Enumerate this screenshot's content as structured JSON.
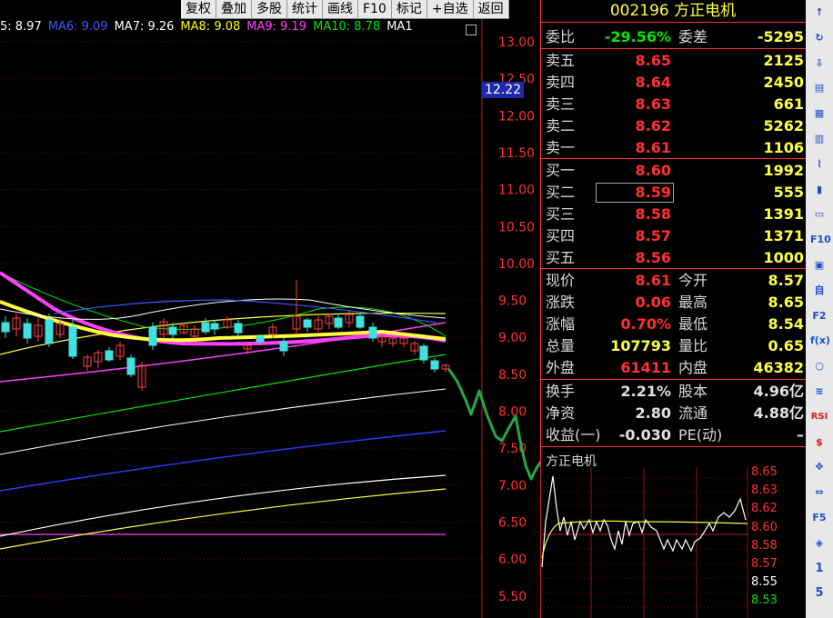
{
  "toolbar": [
    "复权",
    "叠加",
    "多股",
    "统计",
    "画线",
    "F10",
    "标记",
    "+自选",
    "返回"
  ],
  "ma_row": [
    {
      "text": "5: 8.97",
      "color": "#ffffff"
    },
    {
      "text": "MA6: 9.09",
      "color": "#3a5bff"
    },
    {
      "text": "MA7: 9.26",
      "color": "#ffffff"
    },
    {
      "text": "MA8: 9.08",
      "color": "#ffff00"
    },
    {
      "text": "MA9: 9.19",
      "color": "#ff40ff"
    },
    {
      "text": "MA10: 8.78",
      "color": "#00e600"
    },
    {
      "text": "MA1",
      "color": "#ffffff"
    }
  ],
  "axis_labels": [
    "13.00",
    "12.50",
    "12.00",
    "11.50",
    "11.00",
    "10.50",
    "10.00",
    "9.50",
    "9.00",
    "8.50",
    "8.00",
    "7.50",
    "7.00",
    "6.50",
    "6.00",
    "5.50"
  ],
  "price_tag": "12.22",
  "stock": {
    "code": "002196",
    "name": "方正电机"
  },
  "weibi": {
    "label": "委比",
    "value": "-29.56%",
    "label2": "委差",
    "value2": "-5295"
  },
  "sell": [
    {
      "label": "卖五",
      "price": "8.65",
      "vol": "2125"
    },
    {
      "label": "卖四",
      "price": "8.64",
      "vol": "2450"
    },
    {
      "label": "卖三",
      "price": "8.63",
      "vol": "661"
    },
    {
      "label": "卖二",
      "price": "8.62",
      "vol": "5262"
    },
    {
      "label": "卖一",
      "price": "8.61",
      "vol": "1106"
    }
  ],
  "buy": [
    {
      "label": "买一",
      "price": "8.60",
      "vol": "1992"
    },
    {
      "label": "买二",
      "price": "8.59",
      "vol": "555"
    },
    {
      "label": "买三",
      "price": "8.58",
      "vol": "1391"
    },
    {
      "label": "买四",
      "price": "8.57",
      "vol": "1371"
    },
    {
      "label": "买五",
      "price": "8.56",
      "vol": "1000"
    }
  ],
  "quote": [
    {
      "l1": "现价",
      "v1": "8.61",
      "c1": "red",
      "l2": "今开",
      "v2": "8.57",
      "c2": "red"
    },
    {
      "l1": "涨跌",
      "v1": "0.06",
      "c1": "red",
      "l2": "最高",
      "v2": "8.65",
      "c2": "red"
    },
    {
      "l1": "涨幅",
      "v1": "0.70%",
      "c1": "red",
      "l2": "最低",
      "v2": "8.54",
      "c2": "green"
    },
    {
      "l1": "总量",
      "v1": "107793",
      "c1": "yellow",
      "l2": "量比",
      "v2": "0.65",
      "c2": "yellow"
    },
    {
      "l1": "外盘",
      "v1": "61411",
      "c1": "red",
      "l2": "内盘",
      "v2": "46382",
      "c2": "green"
    }
  ],
  "fundamentals": [
    {
      "l1": "换手",
      "v1": "2.21%",
      "l2": "股本",
      "v2": "4.96亿"
    },
    {
      "l1": "净资",
      "v1": "2.80",
      "l2": "流通",
      "v2": "4.88亿"
    },
    {
      "l1": "收益(一)",
      "v1": "-0.030",
      "l2": "PE(动)",
      "v2": "–"
    }
  ],
  "mini_chart": {
    "title": "方正电机",
    "labels": [
      "8.65",
      "8.63",
      "8.62",
      "8.60",
      "8.58",
      "8.57",
      "8.55",
      "8.53"
    ]
  },
  "iconbar": [
    "↑",
    "↻",
    "⇩",
    "▤",
    "▦",
    "▥",
    "⌇",
    "▮",
    "▭",
    "F10",
    "▣",
    "自",
    "F2",
    "f(x)",
    "○",
    "≋",
    "RSI",
    "$",
    "✥",
    "⇔",
    "F5",
    "◈",
    "1",
    "5"
  ]
}
